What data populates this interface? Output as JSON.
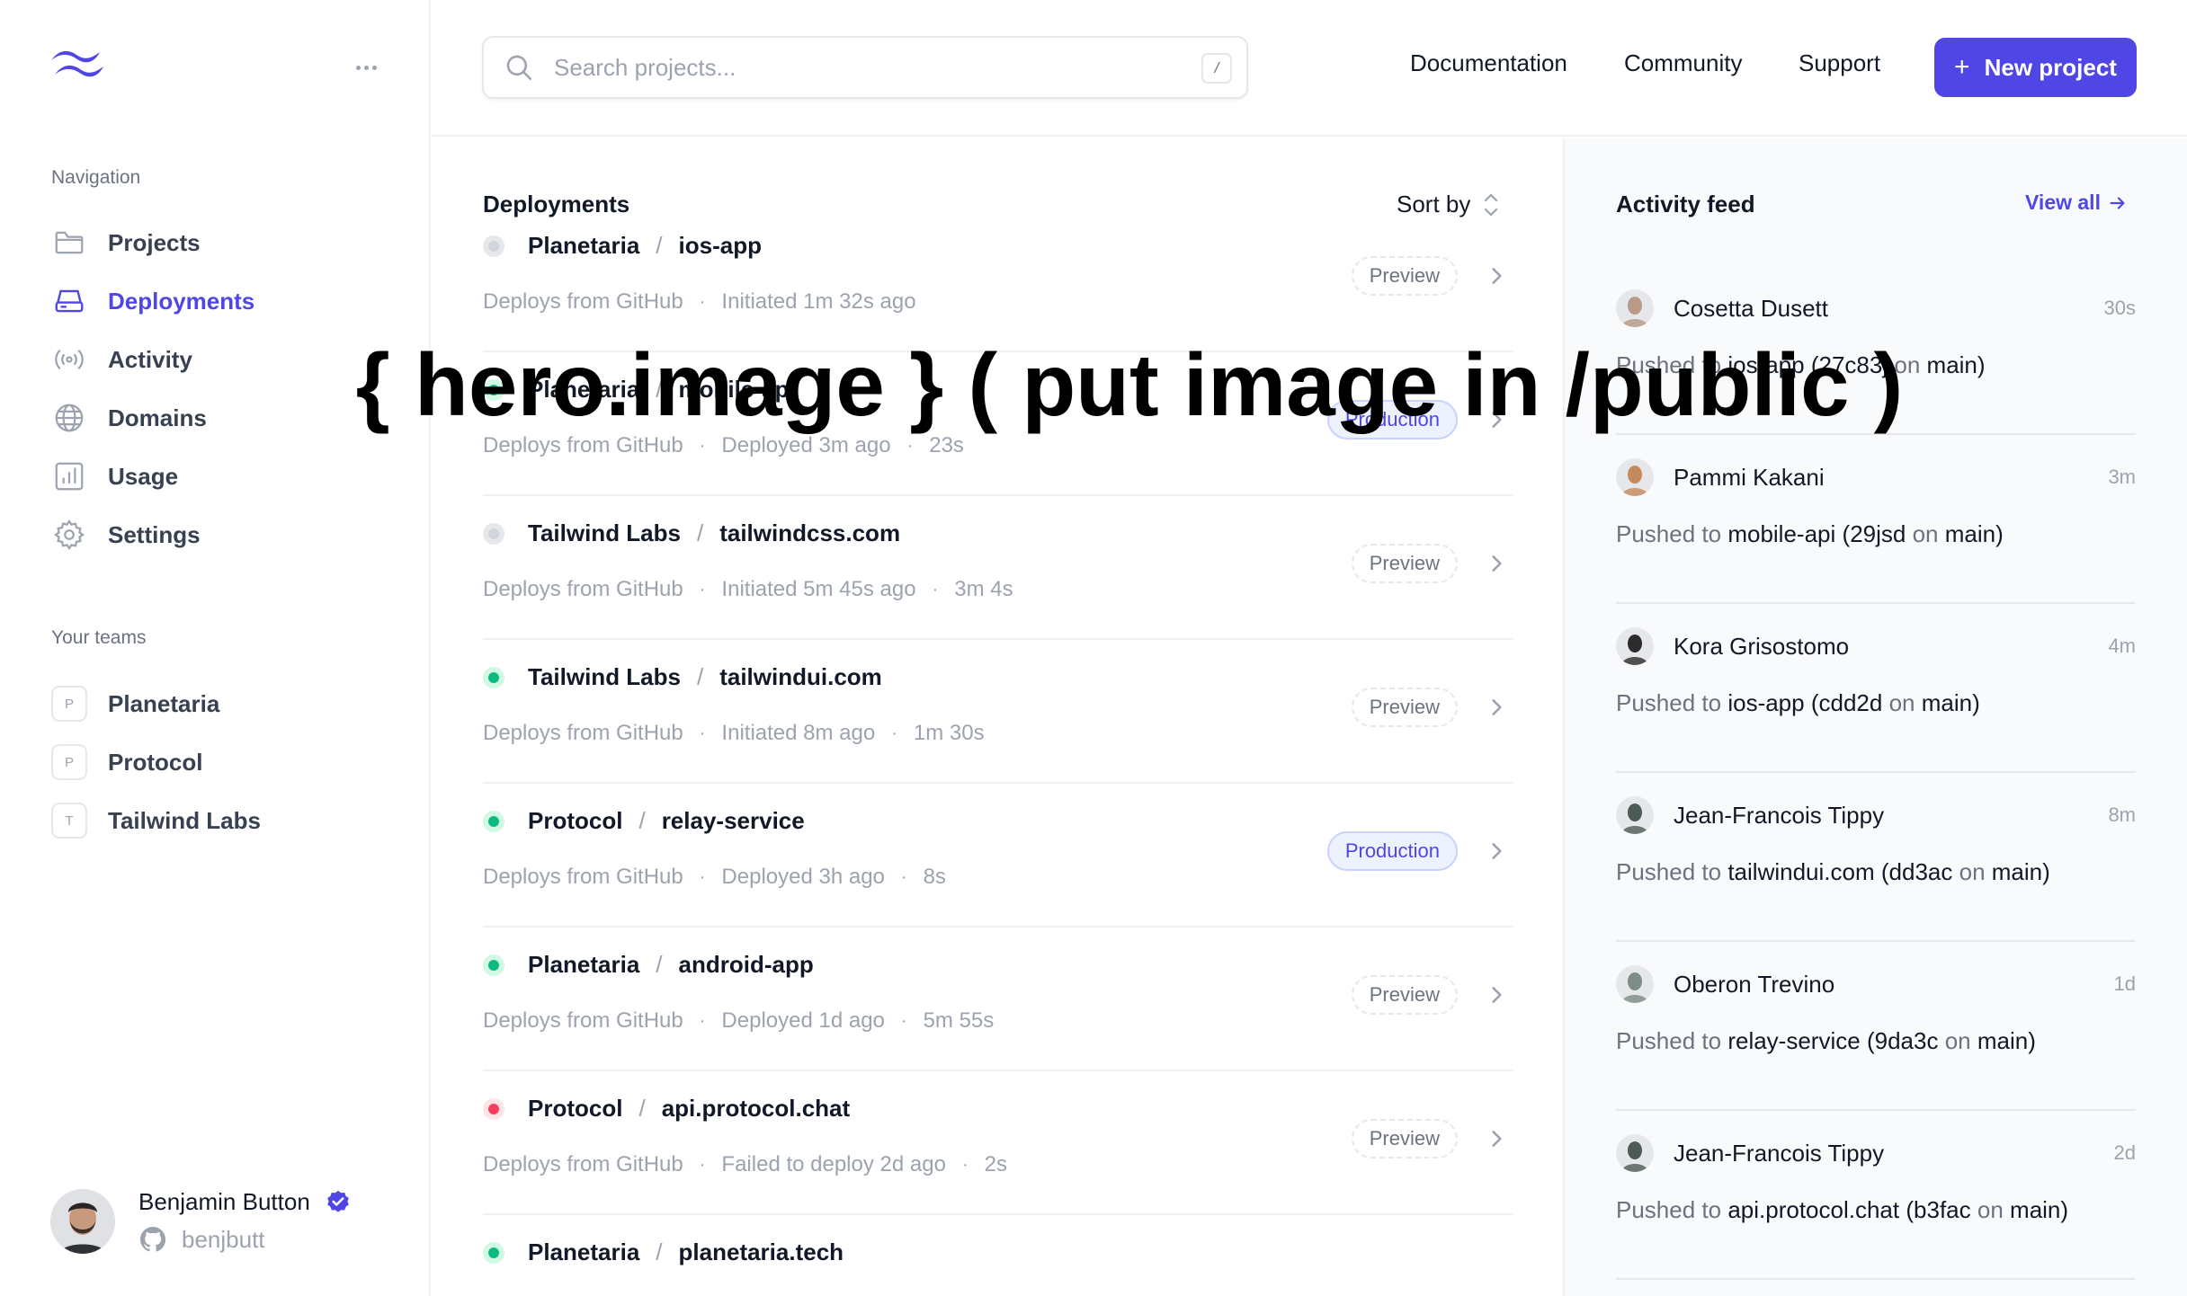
{
  "sidebar": {
    "nav_label": "Navigation",
    "nav_items": [
      {
        "label": "Projects",
        "icon": "folder-icon"
      },
      {
        "label": "Deployments",
        "icon": "server-icon"
      },
      {
        "label": "Activity",
        "icon": "signal-icon"
      },
      {
        "label": "Domains",
        "icon": "globe-icon"
      },
      {
        "label": "Usage",
        "icon": "chart-icon"
      },
      {
        "label": "Settings",
        "icon": "gear-icon"
      }
    ],
    "teams_label": "Your teams",
    "teams": [
      {
        "initial": "P",
        "label": "Planetaria"
      },
      {
        "initial": "P",
        "label": "Protocol"
      },
      {
        "initial": "T",
        "label": "Tailwind Labs"
      }
    ],
    "user": {
      "name": "Benjamin Button",
      "handle": "benjbutt"
    }
  },
  "header": {
    "search_placeholder": "Search projects...",
    "search_shortcut": "/",
    "links": [
      "Documentation",
      "Community",
      "Support"
    ],
    "new_project_label": "New project",
    "new_project_icon": "+"
  },
  "deployments": {
    "title": "Deployments",
    "sort_label": "Sort by",
    "rows": [
      {
        "team": "Planetaria",
        "project": "ios-app",
        "status": "gray",
        "source": "Deploys from GitHub",
        "state": "Initiated 1m 32s ago",
        "duration": "",
        "env": "Preview"
      },
      {
        "team": "Planetaria",
        "project": "mobile-api",
        "status": "green",
        "source": "Deploys from GitHub",
        "state": "Deployed 3m ago",
        "duration": "23s",
        "env": "Production"
      },
      {
        "team": "Tailwind Labs",
        "project": "tailwindcss.com",
        "status": "gray",
        "source": "Deploys from GitHub",
        "state": "Initiated 5m 45s ago",
        "duration": "3m 4s",
        "env": "Preview"
      },
      {
        "team": "Tailwind Labs",
        "project": "tailwindui.com",
        "status": "green",
        "source": "Deploys from GitHub",
        "state": "Initiated 8m ago",
        "duration": "1m 30s",
        "env": "Preview"
      },
      {
        "team": "Protocol",
        "project": "relay-service",
        "status": "green",
        "source": "Deploys from GitHub",
        "state": "Deployed 3h ago",
        "duration": "8s",
        "env": "Production"
      },
      {
        "team": "Planetaria",
        "project": "android-app",
        "status": "green",
        "source": "Deploys from GitHub",
        "state": "Deployed 1d ago",
        "duration": "5m 55s",
        "env": "Preview"
      },
      {
        "team": "Protocol",
        "project": "api.protocol.chat",
        "status": "red",
        "source": "Deploys from GitHub",
        "state": "Failed to deploy 2d ago",
        "duration": "2s",
        "env": "Preview"
      },
      {
        "team": "Planetaria",
        "project": "planetaria.tech",
        "status": "green",
        "source": "",
        "state": "",
        "duration": "",
        "env": ""
      }
    ]
  },
  "activity": {
    "title": "Activity feed",
    "view_all_label": "View all",
    "items": [
      {
        "name": "Cosetta Dusett",
        "time": "30s",
        "prefix": "Pushed to",
        "project": "ios-app",
        "commit": "27c83j",
        "on_word": "on",
        "branch": "main",
        "avatar_color": "#b89a86"
      },
      {
        "name": "Pammi Kakani",
        "time": "3m",
        "prefix": "Pushed to",
        "project": "mobile-api",
        "commit": "29jsd",
        "on_word": "on",
        "branch": "main",
        "avatar_color": "#c58a5c"
      },
      {
        "name": "Kora Grisostomo",
        "time": "4m",
        "prefix": "Pushed to",
        "project": "ios-app",
        "commit": "cdd2d",
        "on_word": "on",
        "branch": "main",
        "avatar_color": "#2b2b2b"
      },
      {
        "name": "Jean-Francois Tippy",
        "time": "8m",
        "prefix": "Pushed to",
        "project": "tailwindui.com",
        "commit": "dd3ac",
        "on_word": "on",
        "branch": "main",
        "avatar_color": "#4d5a55"
      },
      {
        "name": "Oberon Trevino",
        "time": "1d",
        "prefix": "Pushed to",
        "project": "relay-service",
        "commit": "9da3c",
        "on_word": "on",
        "branch": "main",
        "avatar_color": "#7d8c84"
      },
      {
        "name": "Jean-Francois Tippy",
        "time": "2d",
        "prefix": "Pushed to",
        "project": "api.protocol.chat",
        "commit": "b3fac",
        "on_word": "on",
        "branch": "main",
        "avatar_color": "#4d5a55"
      }
    ]
  },
  "overlay": {
    "text": "{ hero.image } ( put image in /public )"
  },
  "colors": {
    "accent": "#4f46e5",
    "green": "#10b981",
    "gray": "#d1d5db",
    "red": "#f43f5e"
  }
}
